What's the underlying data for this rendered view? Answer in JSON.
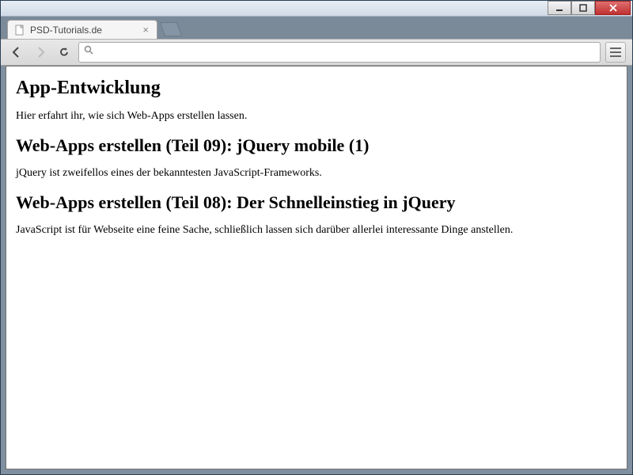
{
  "window": {
    "tab_title": "PSD-Tutorials.de",
    "url_value": ""
  },
  "page": {
    "h1": "App-Entwicklung",
    "intro": "Hier erfahrt ihr, wie sich Web-Apps erstellen lassen.",
    "articles": [
      {
        "heading": "Web-Apps erstellen (Teil 09): jQuery mobile (1)",
        "text": "jQuery ist zweifellos eines der bekanntesten JavaScript-Frameworks."
      },
      {
        "heading": "Web-Apps erstellen (Teil 08): Der Schnelleinstieg in jQuery",
        "text": "JavaScript ist für Webseite eine feine Sache, schließlich lassen sich darüber allerlei interessante Dinge anstellen."
      }
    ]
  }
}
